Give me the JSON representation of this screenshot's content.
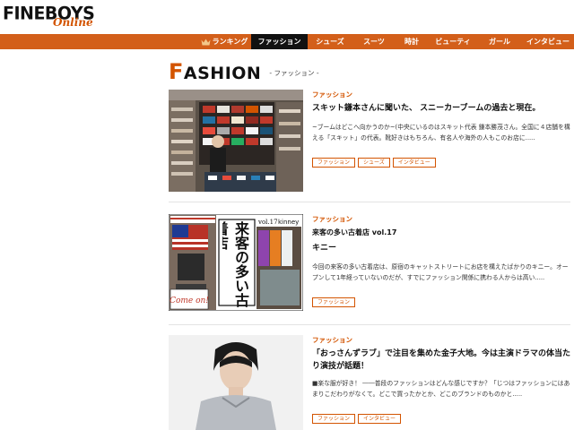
{
  "header": {
    "logo_main": "FINEBOYS",
    "logo_sub": "Online"
  },
  "nav": {
    "items": [
      {
        "label": "ランキング",
        "icon": "crown-icon"
      },
      {
        "label": "ファッション",
        "active": true
      },
      {
        "label": "シューズ"
      },
      {
        "label": "スーツ"
      },
      {
        "label": "時計"
      },
      {
        "label": "ビューティ"
      },
      {
        "label": "ガール"
      },
      {
        "label": "インタビュー"
      }
    ]
  },
  "section": {
    "title_first": "F",
    "title_rest": "ASHION",
    "subtitle": "- ファッション -"
  },
  "articles": [
    {
      "category": "ファッション",
      "title": "スキット鎌本さんに聞いた、 スニーカーブームの過去と現在。",
      "subtitle": "",
      "excerpt": "~ブームはどこへ向かうのか~(中央にいるのはスキット代表 鎌本勝茂さん。全国に４店舗を構える「スキット」の代表。靴好きはもちろん、有名人や海外の人もこのお店に.....",
      "tags": [
        "ファッション",
        "シューズ",
        "インタビュー"
      ]
    },
    {
      "category": "ファッション",
      "title": "来客の多い古着店 vol.17",
      "subtitle": "キニー",
      "excerpt": "今回の来客の多い古着店は、原宿のキャットストリートにお店を構えたばかりのキニー。オープンして1年経っていないのだが、すでにファッション関係に携わる人からは高い.....",
      "tags": [
        "ファッション"
      ],
      "thumb_text": {
        "vol": "vol.17",
        "brand": "kinney",
        "main": "来客の多い古着店",
        "badge": "Come on!"
      }
    },
    {
      "category": "ファッション",
      "title": "「おっさんずラブ」で注目を集めた金子大地。今は主演ドラマの体当たり演技が話題！",
      "subtitle": "",
      "excerpt": "■楽な服が好き！ ――普段のファッションはどんな感じですか？「じつはファッションにはあまりこだわりがなくて。どこで買ったかとか、どこのブランドのものかと.....",
      "tags": [
        "ファッション",
        "インタビュー"
      ]
    }
  ],
  "colors": {
    "accent": "#d35400",
    "nav_bg": "#d35f1a",
    "nav_active": "#111111"
  }
}
